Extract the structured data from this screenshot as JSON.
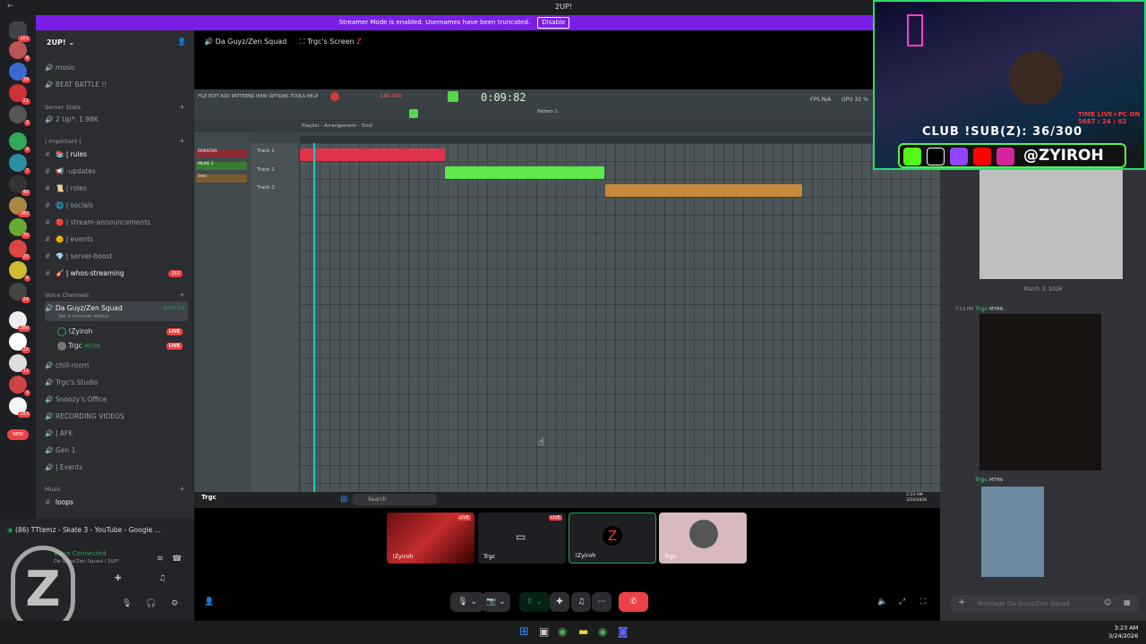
{
  "window": {
    "title": "2UP!"
  },
  "banner": {
    "text": "Streamer Mode is enabled. Usernames have been truncated.",
    "button": "Disable"
  },
  "server": {
    "name": "2UP!"
  },
  "rail": {
    "badges": [
      "161",
      "8",
      "19",
      "21",
      "3",
      "9",
      "7",
      "40",
      "180",
      "35",
      "25",
      "6",
      "24",
      "380",
      "22",
      "11",
      "4",
      "253",
      "NEW"
    ]
  },
  "sidebar": {
    "top_channels": [
      {
        "label": "music",
        "icon": "speaker-icon"
      },
      {
        "label": "BEAT BATTLE !!",
        "icon": "speaker-icon"
      }
    ],
    "server_stats": {
      "label": "Server Stats",
      "members": "2 Up*: 1.98K"
    },
    "important": {
      "label": "| important |"
    },
    "channels": [
      {
        "label": "| rules",
        "icon": "📚"
      },
      {
        "label": "-updates",
        "icon": "📢"
      },
      {
        "label": "| roles",
        "icon": "📜"
      },
      {
        "label": "| socials",
        "icon": "🌐"
      },
      {
        "label": "| stream-announcements",
        "icon": "🔴"
      },
      {
        "label": "| events",
        "icon": "🌞"
      },
      {
        "label": "| server-boost",
        "icon": "💎"
      },
      {
        "label": "| whos-streaming",
        "icon": "🎸",
        "count": "262"
      }
    ],
    "voice_category": "Voice Channels",
    "voice_active": {
      "label": "Da Guyz/Zen Squad",
      "timer": "6:04:33",
      "status": "Set a channel status"
    },
    "voice_users": [
      {
        "name": "!Zyiroh",
        "live": "LIVE"
      },
      {
        "name": "Trgc",
        "tag": "MTHN",
        "live": "LIVE"
      }
    ],
    "voice_channels": [
      "chill-room",
      "Trgc's Studio",
      "Snoozy's Office",
      "RECORDING VIDEOS",
      "| AFK",
      "Gen 1",
      "| Events"
    ],
    "music_category": "Music",
    "music_channels": [
      "loops"
    ]
  },
  "user_panel": {
    "tab": "(86) TTtemz - Skate 3 - YouTube - Google ...",
    "status": "Voice Connected",
    "sub": "Da Guyz/Zen Squad / 2UP!"
  },
  "call": {
    "channel": "Da Guyz/Zen Squad",
    "screen": "Trgc's Screen",
    "sharer_label": "Trgc"
  },
  "fl": {
    "menu": "FILE  EDIT  ADD  PATTERNS  VIEW  OPTIONS  TOOLS  HELP",
    "time": "0:09:82",
    "tempo": "140.000",
    "pattern": "Pattern 1",
    "fps": "FPS N/A",
    "cpu": "GPU 32 %",
    "playlist": "Playlist - Arrangement - 5mil",
    "tracks": [
      "Track 1",
      "Track 2",
      "Track 3"
    ],
    "pickers": [
      "ROKSTAR",
      "MLNG 2",
      "5mil"
    ]
  },
  "inner_taskbar": {
    "search": "Search",
    "time": "3:23 AM",
    "date": "3/24/2026"
  },
  "tiles": [
    {
      "name": "!Zyiroh",
      "live": "LIVE"
    },
    {
      "name": "Trgc",
      "live": "LIVE"
    },
    {
      "name": "!Zyiroh"
    },
    {
      "name": "Trgc"
    }
  ],
  "chat": {
    "date_divider": "March 3, 2026",
    "msg1": {
      "time": "7:53 PM",
      "author": "Trgc",
      "tag": "MTHN"
    },
    "msg2": {
      "author": "Trgc",
      "tag": "MTHN"
    },
    "input_placeholder": "Message Da Guyz/Zen Squad"
  },
  "overlay": {
    "club": "CLUB !SUB(Z): 36/300",
    "handle": "@ZYIROH",
    "timer": "TIME LIVE+PC ON  5687 : 24 : 02"
  },
  "os": {
    "time": "3:23 AM",
    "date": "3/24/2026"
  },
  "colors": {
    "discord_bg": "#313338",
    "sidebar": "#2b2d31",
    "rail": "#1e1f22",
    "banner": "#7a1ee6",
    "live": "#ed4245",
    "clip_red": "#e0334a",
    "clip_green": "#5fe84a",
    "clip_orange": "#c98a3a",
    "accent_green": "#23a55a"
  }
}
